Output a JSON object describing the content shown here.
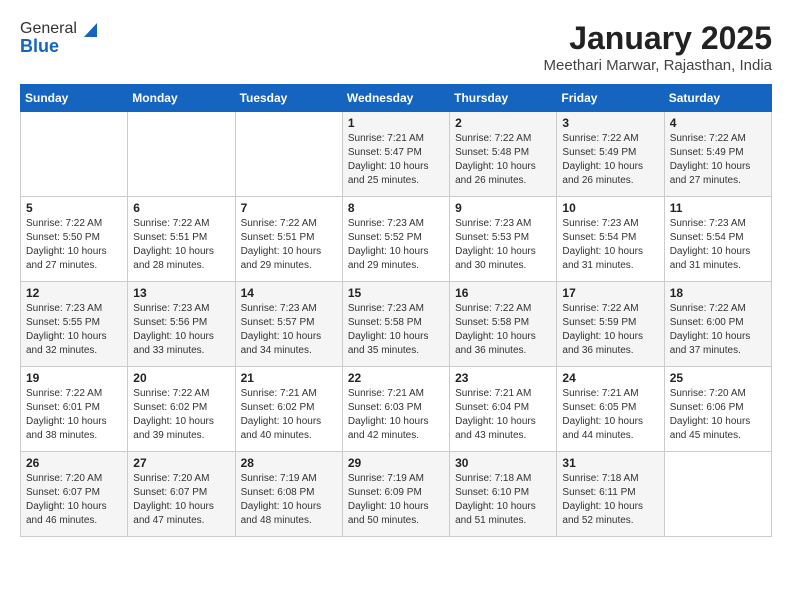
{
  "header": {
    "logo_line1": "General",
    "logo_line2": "Blue",
    "month_year": "January 2025",
    "location": "Meethari Marwar, Rajasthan, India"
  },
  "weekdays": [
    "Sunday",
    "Monday",
    "Tuesday",
    "Wednesday",
    "Thursday",
    "Friday",
    "Saturday"
  ],
  "weeks": [
    [
      {
        "day": "",
        "content": ""
      },
      {
        "day": "",
        "content": ""
      },
      {
        "day": "",
        "content": ""
      },
      {
        "day": "1",
        "content": "Sunrise: 7:21 AM\nSunset: 5:47 PM\nDaylight: 10 hours\nand 25 minutes."
      },
      {
        "day": "2",
        "content": "Sunrise: 7:22 AM\nSunset: 5:48 PM\nDaylight: 10 hours\nand 26 minutes."
      },
      {
        "day": "3",
        "content": "Sunrise: 7:22 AM\nSunset: 5:49 PM\nDaylight: 10 hours\nand 26 minutes."
      },
      {
        "day": "4",
        "content": "Sunrise: 7:22 AM\nSunset: 5:49 PM\nDaylight: 10 hours\nand 27 minutes."
      }
    ],
    [
      {
        "day": "5",
        "content": "Sunrise: 7:22 AM\nSunset: 5:50 PM\nDaylight: 10 hours\nand 27 minutes."
      },
      {
        "day": "6",
        "content": "Sunrise: 7:22 AM\nSunset: 5:51 PM\nDaylight: 10 hours\nand 28 minutes."
      },
      {
        "day": "7",
        "content": "Sunrise: 7:22 AM\nSunset: 5:51 PM\nDaylight: 10 hours\nand 29 minutes."
      },
      {
        "day": "8",
        "content": "Sunrise: 7:23 AM\nSunset: 5:52 PM\nDaylight: 10 hours\nand 29 minutes."
      },
      {
        "day": "9",
        "content": "Sunrise: 7:23 AM\nSunset: 5:53 PM\nDaylight: 10 hours\nand 30 minutes."
      },
      {
        "day": "10",
        "content": "Sunrise: 7:23 AM\nSunset: 5:54 PM\nDaylight: 10 hours\nand 31 minutes."
      },
      {
        "day": "11",
        "content": "Sunrise: 7:23 AM\nSunset: 5:54 PM\nDaylight: 10 hours\nand 31 minutes."
      }
    ],
    [
      {
        "day": "12",
        "content": "Sunrise: 7:23 AM\nSunset: 5:55 PM\nDaylight: 10 hours\nand 32 minutes."
      },
      {
        "day": "13",
        "content": "Sunrise: 7:23 AM\nSunset: 5:56 PM\nDaylight: 10 hours\nand 33 minutes."
      },
      {
        "day": "14",
        "content": "Sunrise: 7:23 AM\nSunset: 5:57 PM\nDaylight: 10 hours\nand 34 minutes."
      },
      {
        "day": "15",
        "content": "Sunrise: 7:23 AM\nSunset: 5:58 PM\nDaylight: 10 hours\nand 35 minutes."
      },
      {
        "day": "16",
        "content": "Sunrise: 7:22 AM\nSunset: 5:58 PM\nDaylight: 10 hours\nand 36 minutes."
      },
      {
        "day": "17",
        "content": "Sunrise: 7:22 AM\nSunset: 5:59 PM\nDaylight: 10 hours\nand 36 minutes."
      },
      {
        "day": "18",
        "content": "Sunrise: 7:22 AM\nSunset: 6:00 PM\nDaylight: 10 hours\nand 37 minutes."
      }
    ],
    [
      {
        "day": "19",
        "content": "Sunrise: 7:22 AM\nSunset: 6:01 PM\nDaylight: 10 hours\nand 38 minutes."
      },
      {
        "day": "20",
        "content": "Sunrise: 7:22 AM\nSunset: 6:02 PM\nDaylight: 10 hours\nand 39 minutes."
      },
      {
        "day": "21",
        "content": "Sunrise: 7:21 AM\nSunset: 6:02 PM\nDaylight: 10 hours\nand 40 minutes."
      },
      {
        "day": "22",
        "content": "Sunrise: 7:21 AM\nSunset: 6:03 PM\nDaylight: 10 hours\nand 42 minutes."
      },
      {
        "day": "23",
        "content": "Sunrise: 7:21 AM\nSunset: 6:04 PM\nDaylight: 10 hours\nand 43 minutes."
      },
      {
        "day": "24",
        "content": "Sunrise: 7:21 AM\nSunset: 6:05 PM\nDaylight: 10 hours\nand 44 minutes."
      },
      {
        "day": "25",
        "content": "Sunrise: 7:20 AM\nSunset: 6:06 PM\nDaylight: 10 hours\nand 45 minutes."
      }
    ],
    [
      {
        "day": "26",
        "content": "Sunrise: 7:20 AM\nSunset: 6:07 PM\nDaylight: 10 hours\nand 46 minutes."
      },
      {
        "day": "27",
        "content": "Sunrise: 7:20 AM\nSunset: 6:07 PM\nDaylight: 10 hours\nand 47 minutes."
      },
      {
        "day": "28",
        "content": "Sunrise: 7:19 AM\nSunset: 6:08 PM\nDaylight: 10 hours\nand 48 minutes."
      },
      {
        "day": "29",
        "content": "Sunrise: 7:19 AM\nSunset: 6:09 PM\nDaylight: 10 hours\nand 50 minutes."
      },
      {
        "day": "30",
        "content": "Sunrise: 7:18 AM\nSunset: 6:10 PM\nDaylight: 10 hours\nand 51 minutes."
      },
      {
        "day": "31",
        "content": "Sunrise: 7:18 AM\nSunset: 6:11 PM\nDaylight: 10 hours\nand 52 minutes."
      },
      {
        "day": "",
        "content": ""
      }
    ]
  ]
}
